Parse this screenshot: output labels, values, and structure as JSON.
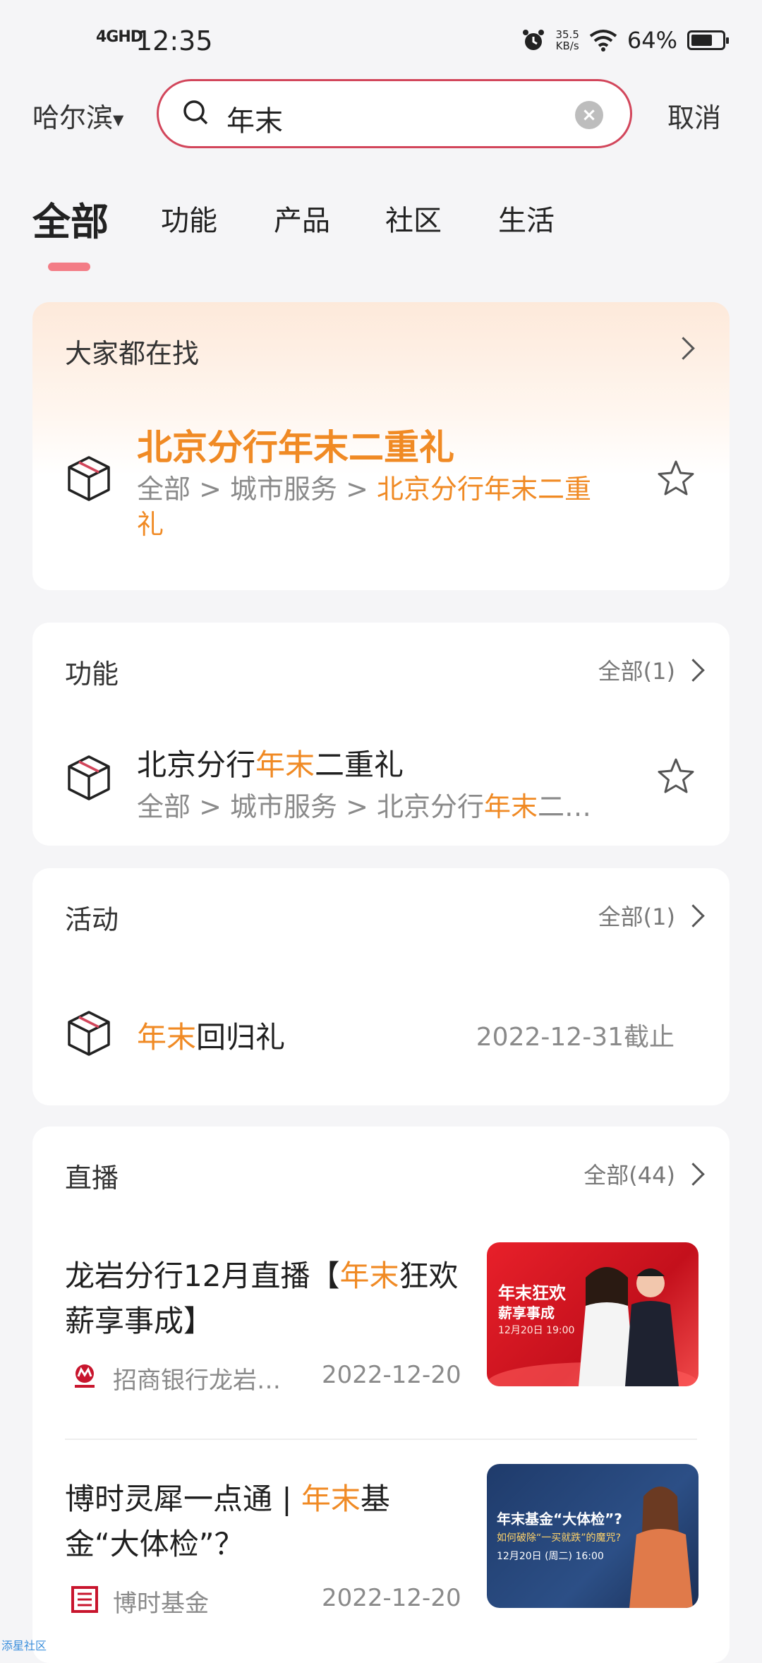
{
  "status_bar": {
    "signal": "4GHD",
    "time": "12:35",
    "speed": "35.5\nKB/s",
    "battery": "64%"
  },
  "header": {
    "city": "哈尔滨",
    "search_value": "年末",
    "cancel_label": "取消"
  },
  "tabs": [
    {
      "label": "全部"
    },
    {
      "label": "功能"
    },
    {
      "label": "产品"
    },
    {
      "label": "社区"
    },
    {
      "label": "生活"
    }
  ],
  "trending": {
    "title": "大家都在找",
    "item_title": "北京分行年末二重礼",
    "path_prefix": "全部 > 城市服务 > ",
    "path_highlight": "北京分行年末二重",
    "path_wrap": "礼"
  },
  "features": {
    "title": "功能",
    "more": "全部(1)",
    "item": {
      "title_pre": "北京分行",
      "title_hl": "年末",
      "title_post": "二重礼",
      "path_pre": "全部 > 城市服务 > 北京分行",
      "path_hl": "年末",
      "path_post": "二…"
    }
  },
  "activities": {
    "title": "活动",
    "more": "全部(1)",
    "item": {
      "title_hl": "年末",
      "title_post": "回归礼",
      "deadline": "2022-12-31截止"
    }
  },
  "live": {
    "title": "直播",
    "more": "全部(44)",
    "items": [
      {
        "title_pre": "龙岩分行12月直播【",
        "title_hl": "年末",
        "title_post": "狂欢 薪享事成】",
        "source": "招商银行龙岩…",
        "date": "2022-12-20",
        "thumb_line1": "年末狂欢",
        "thumb_line2": "薪享事成",
        "thumb_line3": "12月20日 19:00"
      },
      {
        "title_pre": "博时灵犀一点通 | ",
        "title_hl": "年末",
        "title_post": "基金“大体检”？",
        "source": "博时基金",
        "date": "2022-12-20",
        "thumb_line1": "年末基金“大体检”?",
        "thumb_line2": "如何破除“一买就跌”的魔咒?",
        "thumb_line3": "12月20日 (周二) 16:00"
      }
    ]
  },
  "footer_tag": "添星社区",
  "colors": {
    "accent": "#d2465b",
    "highlight": "#f08a24",
    "background": "#f5f5f7"
  }
}
